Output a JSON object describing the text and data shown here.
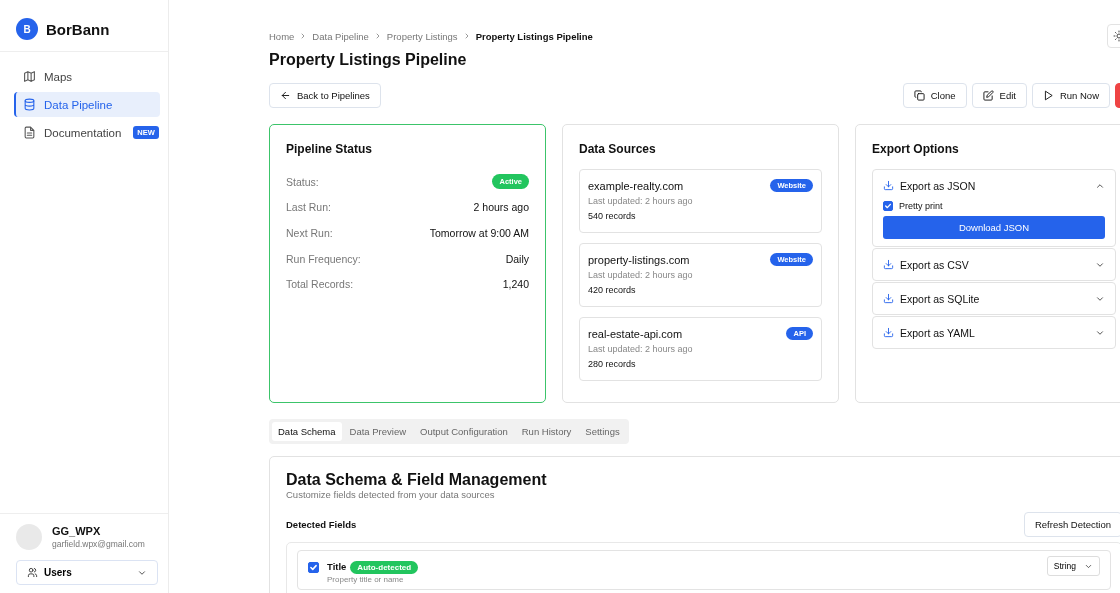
{
  "sidebar": {
    "brand": {
      "initial": "B",
      "name": "BorBann"
    },
    "nav": [
      {
        "label": "Maps",
        "selected": false
      },
      {
        "label": "Data Pipeline",
        "selected": true
      },
      {
        "label": "Documentation",
        "selected": false,
        "badge": "NEW"
      }
    ],
    "user": {
      "name": "GG_WPX",
      "email": "garfield.wpx@gmail.com"
    },
    "role_select": {
      "value": "Users"
    }
  },
  "breadcrumb": [
    "Home",
    "Data Pipeline",
    "Property Listings",
    "Property Listings Pipeline"
  ],
  "title": "Property Listings Pipeline",
  "back_button": "Back to Pipelines",
  "actions": [
    {
      "label": "Clone",
      "kind": "clone"
    },
    {
      "label": "Edit",
      "kind": "edit"
    },
    {
      "label": "Run Now",
      "kind": "run"
    },
    {
      "kind": "delete"
    }
  ],
  "status_card": {
    "title": "Pipeline Status",
    "rows": [
      {
        "label": "Status:",
        "value": "Active",
        "kind": "badge"
      },
      {
        "label": "Last Run:",
        "value": "2 hours ago",
        "kind": "text"
      },
      {
        "label": "Next Run:",
        "value": "Tomorrow at 9:00 AM",
        "kind": "text"
      },
      {
        "label": "Run Frequency:",
        "value": "Daily",
        "kind": "text"
      },
      {
        "label": "Total Records:",
        "value": "1,240",
        "kind": "text"
      }
    ]
  },
  "sources_card": {
    "title": "Data Sources",
    "items": [
      {
        "name": "example-realty.com",
        "type": "Website",
        "updated": "Last updated: 2 hours ago",
        "records": "540 records"
      },
      {
        "name": "property-listings.com",
        "type": "Website",
        "updated": "Last updated: 2 hours ago",
        "records": "420 records"
      },
      {
        "name": "real-estate-api.com",
        "type": "API",
        "updated": "Last updated: 2 hours ago",
        "records": "280 records"
      }
    ]
  },
  "export_card": {
    "title": "Export Options",
    "options": [
      {
        "label": "Export as JSON",
        "expanded": true,
        "option": {
          "label": "Pretty print",
          "checked": true
        },
        "button": "Download JSON"
      },
      {
        "label": "Export as CSV",
        "expanded": false
      },
      {
        "label": "Export as SQLite",
        "expanded": false
      },
      {
        "label": "Export as YAML",
        "expanded": false
      }
    ]
  },
  "tabs": [
    {
      "label": "Data Schema",
      "selected": true
    },
    {
      "label": "Data Preview",
      "selected": false
    },
    {
      "label": "Output Configuration",
      "selected": false
    },
    {
      "label": "Run History",
      "selected": false
    },
    {
      "label": "Settings",
      "selected": false
    }
  ],
  "schema": {
    "title": "Data Schema & Field Management",
    "subtitle": "Customize fields detected from your data sources",
    "detected_label": "Detected Fields",
    "refresh_button": "Refresh Detection",
    "fields": [
      {
        "name": "Title",
        "badge": "Auto-detected",
        "description": "Property title or name",
        "checked": true,
        "type": "String"
      }
    ]
  }
}
